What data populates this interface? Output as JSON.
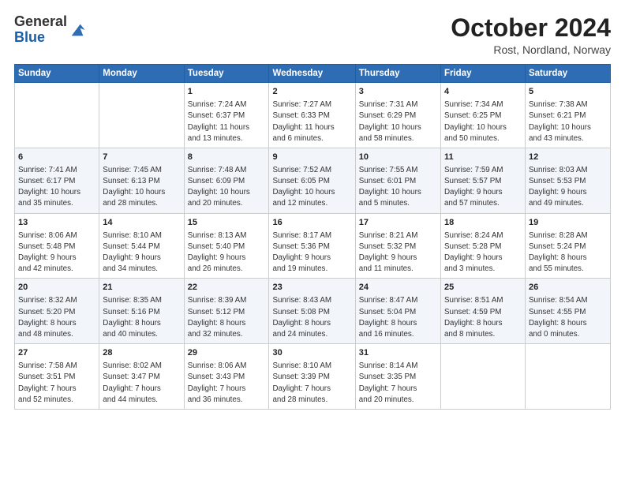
{
  "logo": {
    "general": "General",
    "blue": "Blue"
  },
  "header": {
    "title": "October 2024",
    "subtitle": "Rost, Nordland, Norway"
  },
  "weekdays": [
    "Sunday",
    "Monday",
    "Tuesday",
    "Wednesday",
    "Thursday",
    "Friday",
    "Saturday"
  ],
  "weeks": [
    [
      {
        "day": "",
        "info": ""
      },
      {
        "day": "",
        "info": ""
      },
      {
        "day": "1",
        "info": "Sunrise: 7:24 AM\nSunset: 6:37 PM\nDaylight: 11 hours\nand 13 minutes."
      },
      {
        "day": "2",
        "info": "Sunrise: 7:27 AM\nSunset: 6:33 PM\nDaylight: 11 hours\nand 6 minutes."
      },
      {
        "day": "3",
        "info": "Sunrise: 7:31 AM\nSunset: 6:29 PM\nDaylight: 10 hours\nand 58 minutes."
      },
      {
        "day": "4",
        "info": "Sunrise: 7:34 AM\nSunset: 6:25 PM\nDaylight: 10 hours\nand 50 minutes."
      },
      {
        "day": "5",
        "info": "Sunrise: 7:38 AM\nSunset: 6:21 PM\nDaylight: 10 hours\nand 43 minutes."
      }
    ],
    [
      {
        "day": "6",
        "info": "Sunrise: 7:41 AM\nSunset: 6:17 PM\nDaylight: 10 hours\nand 35 minutes."
      },
      {
        "day": "7",
        "info": "Sunrise: 7:45 AM\nSunset: 6:13 PM\nDaylight: 10 hours\nand 28 minutes."
      },
      {
        "day": "8",
        "info": "Sunrise: 7:48 AM\nSunset: 6:09 PM\nDaylight: 10 hours\nand 20 minutes."
      },
      {
        "day": "9",
        "info": "Sunrise: 7:52 AM\nSunset: 6:05 PM\nDaylight: 10 hours\nand 12 minutes."
      },
      {
        "day": "10",
        "info": "Sunrise: 7:55 AM\nSunset: 6:01 PM\nDaylight: 10 hours\nand 5 minutes."
      },
      {
        "day": "11",
        "info": "Sunrise: 7:59 AM\nSunset: 5:57 PM\nDaylight: 9 hours\nand 57 minutes."
      },
      {
        "day": "12",
        "info": "Sunrise: 8:03 AM\nSunset: 5:53 PM\nDaylight: 9 hours\nand 49 minutes."
      }
    ],
    [
      {
        "day": "13",
        "info": "Sunrise: 8:06 AM\nSunset: 5:48 PM\nDaylight: 9 hours\nand 42 minutes."
      },
      {
        "day": "14",
        "info": "Sunrise: 8:10 AM\nSunset: 5:44 PM\nDaylight: 9 hours\nand 34 minutes."
      },
      {
        "day": "15",
        "info": "Sunrise: 8:13 AM\nSunset: 5:40 PM\nDaylight: 9 hours\nand 26 minutes."
      },
      {
        "day": "16",
        "info": "Sunrise: 8:17 AM\nSunset: 5:36 PM\nDaylight: 9 hours\nand 19 minutes."
      },
      {
        "day": "17",
        "info": "Sunrise: 8:21 AM\nSunset: 5:32 PM\nDaylight: 9 hours\nand 11 minutes."
      },
      {
        "day": "18",
        "info": "Sunrise: 8:24 AM\nSunset: 5:28 PM\nDaylight: 9 hours\nand 3 minutes."
      },
      {
        "day": "19",
        "info": "Sunrise: 8:28 AM\nSunset: 5:24 PM\nDaylight: 8 hours\nand 55 minutes."
      }
    ],
    [
      {
        "day": "20",
        "info": "Sunrise: 8:32 AM\nSunset: 5:20 PM\nDaylight: 8 hours\nand 48 minutes."
      },
      {
        "day": "21",
        "info": "Sunrise: 8:35 AM\nSunset: 5:16 PM\nDaylight: 8 hours\nand 40 minutes."
      },
      {
        "day": "22",
        "info": "Sunrise: 8:39 AM\nSunset: 5:12 PM\nDaylight: 8 hours\nand 32 minutes."
      },
      {
        "day": "23",
        "info": "Sunrise: 8:43 AM\nSunset: 5:08 PM\nDaylight: 8 hours\nand 24 minutes."
      },
      {
        "day": "24",
        "info": "Sunrise: 8:47 AM\nSunset: 5:04 PM\nDaylight: 8 hours\nand 16 minutes."
      },
      {
        "day": "25",
        "info": "Sunrise: 8:51 AM\nSunset: 4:59 PM\nDaylight: 8 hours\nand 8 minutes."
      },
      {
        "day": "26",
        "info": "Sunrise: 8:54 AM\nSunset: 4:55 PM\nDaylight: 8 hours\nand 0 minutes."
      }
    ],
    [
      {
        "day": "27",
        "info": "Sunrise: 7:58 AM\nSunset: 3:51 PM\nDaylight: 7 hours\nand 52 minutes."
      },
      {
        "day": "28",
        "info": "Sunrise: 8:02 AM\nSunset: 3:47 PM\nDaylight: 7 hours\nand 44 minutes."
      },
      {
        "day": "29",
        "info": "Sunrise: 8:06 AM\nSunset: 3:43 PM\nDaylight: 7 hours\nand 36 minutes."
      },
      {
        "day": "30",
        "info": "Sunrise: 8:10 AM\nSunset: 3:39 PM\nDaylight: 7 hours\nand 28 minutes."
      },
      {
        "day": "31",
        "info": "Sunrise: 8:14 AM\nSunset: 3:35 PM\nDaylight: 7 hours\nand 20 minutes."
      },
      {
        "day": "",
        "info": ""
      },
      {
        "day": "",
        "info": ""
      }
    ]
  ]
}
